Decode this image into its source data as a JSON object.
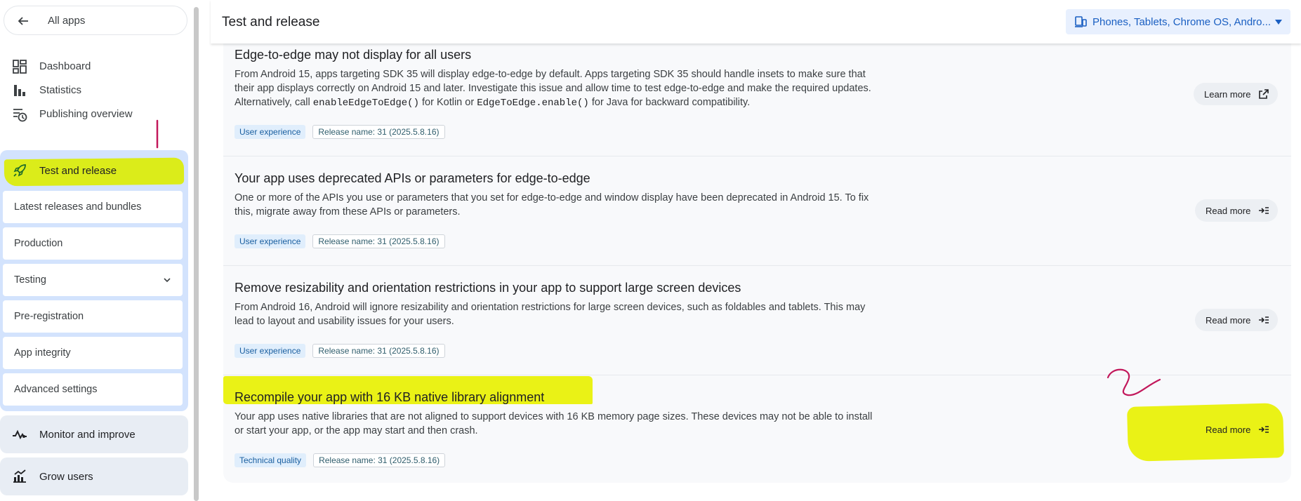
{
  "sidebar": {
    "all_apps": "All apps",
    "nav": [
      {
        "label": "Dashboard",
        "icon": "dashboard-icon"
      },
      {
        "label": "Statistics",
        "icon": "bar-chart-icon"
      },
      {
        "label": "Publishing overview",
        "icon": "publishing-overview-icon"
      }
    ],
    "test_release": {
      "label": "Test and release",
      "icon": "rocket-icon"
    },
    "sub_items": [
      {
        "label": "Latest releases and bundles"
      },
      {
        "label": "Production"
      },
      {
        "label": "Testing",
        "expandable": true
      },
      {
        "label": "Pre-registration"
      },
      {
        "label": "App integrity"
      },
      {
        "label": "Advanced settings"
      }
    ],
    "sections": [
      {
        "label": "Monitor and improve",
        "icon": "monitor-pulse-icon"
      },
      {
        "label": "Grow users",
        "icon": "grow-users-icon"
      }
    ]
  },
  "header": {
    "title": "Test and release",
    "device_filter": "Phones, Tablets, Chrome OS, Andro...",
    "device_icon": "devices-icon"
  },
  "issues": [
    {
      "title": "Edge-to-edge may not display for all users",
      "desc_parts": [
        "From Android 15, apps targeting SDK 35 will display edge-to-edge by default. Apps targeting SDK 35 should handle insets to make sure that their app displays correctly on Android 15 and later. Investigate this issue and allow time to test edge-to-edge and make the required updates. Alternatively, call ",
        "enableEdgeToEdge()",
        " for Kotlin or ",
        "EdgeToEdge.enable()",
        " for Java for backward compatibility."
      ],
      "tags": [
        "User experience",
        "Release name: 31 (2025.5.8.16)"
      ],
      "action": "Learn more",
      "action_icon": "open-in-new-icon"
    },
    {
      "title": "Your app uses deprecated APIs or parameters for edge-to-edge",
      "desc": "One or more of the APIs you use or parameters that you set for edge-to-edge and window display have been deprecated in Android 15. To fix this, migrate away from these APIs or parameters.",
      "tags": [
        "User experience",
        "Release name: 31 (2025.5.8.16)"
      ],
      "action": "Read more",
      "action_icon": "read-more-icon"
    },
    {
      "title": "Remove resizability and orientation restrictions in your app to support large screen devices",
      "desc": "From Android 16, Android will ignore resizability and orientation restrictions for large screen devices, such as foldables and tablets. This may lead to layout and usability issues for your users.",
      "tags": [
        "User experience",
        "Release name: 31 (2025.5.8.16)"
      ],
      "action": "Read more",
      "action_icon": "read-more-icon"
    },
    {
      "title": "Recompile your app with 16 KB native library alignment",
      "desc": "Your app uses native libraries that are not aligned to support devices with 16 KB memory page sizes. These devices may not be able to install or start your app, or the app may start and then crash.",
      "tags": [
        "Technical quality",
        "Release name: 31 (2025.5.8.16)"
      ],
      "action": "Read more",
      "action_icon": "read-more-icon"
    }
  ],
  "colors": {
    "highlight": "#eaf216",
    "accent_blue": "#1a5fc2",
    "annotation_pen": "#c2185b"
  }
}
